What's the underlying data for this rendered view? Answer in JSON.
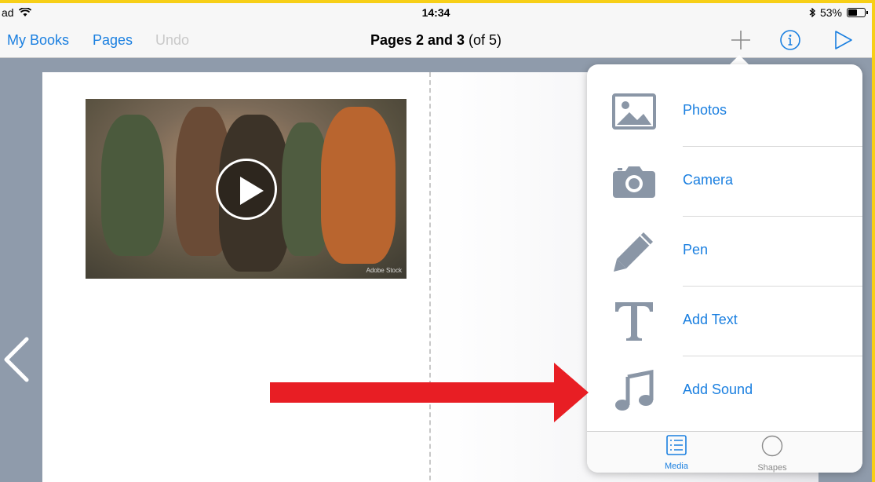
{
  "status_bar": {
    "carrier": "ad",
    "time": "14:34",
    "battery": "53%"
  },
  "nav": {
    "my_books": "My Books",
    "pages": "Pages",
    "undo": "Undo",
    "title_bold": "Pages 2 and 3",
    "title_rest": " (of 5)"
  },
  "video": {
    "watermark": "Adobe Stock"
  },
  "popover": {
    "items": [
      {
        "label": "Photos",
        "icon": "photos-icon"
      },
      {
        "label": "Camera",
        "icon": "camera-icon"
      },
      {
        "label": "Pen",
        "icon": "pen-icon"
      },
      {
        "label": "Add Text",
        "icon": "text-icon"
      },
      {
        "label": "Add Sound",
        "icon": "music-note-icon"
      }
    ],
    "tabs": [
      {
        "label": "Media",
        "icon": "list-icon",
        "selected": true
      },
      {
        "label": "Shapes",
        "icon": "circle-icon",
        "selected": false
      }
    ]
  },
  "colors": {
    "accent": "#1a7fe0",
    "annotation_arrow": "#e81e24",
    "frame": "#f7cf17",
    "icon_gray": "#8a96a6"
  }
}
